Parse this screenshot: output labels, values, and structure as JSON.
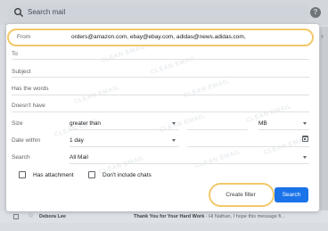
{
  "topbar": {
    "search_placeholder": "Search mail",
    "help_icon": "?"
  },
  "filter": {
    "from_label": "From",
    "from_value": "orders@amazon.com, ebay@ebay.com, adidas@news.adidas.com,",
    "to_label": "To",
    "subject_label": "Subject",
    "has_words_label": "Has the words",
    "doesnt_have_label": "Doesn't have",
    "size_label": "Size",
    "size_operator": "greater than",
    "size_unit": "MB",
    "date_within_label": "Date within",
    "date_within_value": "1 day",
    "search_label": "Search",
    "search_value": "All Mail",
    "has_attachment_label": "Has attachment",
    "dont_include_chats_label": "Don't include chats",
    "create_filter_label": "Create filter",
    "search_button_label": "Search"
  },
  "watermark": "CLEAN EMAIL",
  "email_row": {
    "sender": "Debora Lee",
    "subject": "Thank You for Your Hard Work",
    "snippet": " - Hi Nathan, I hope this message fi..."
  },
  "colors": {
    "highlight_ring": "#f3c86a",
    "primary_button": "#1a73e8"
  }
}
